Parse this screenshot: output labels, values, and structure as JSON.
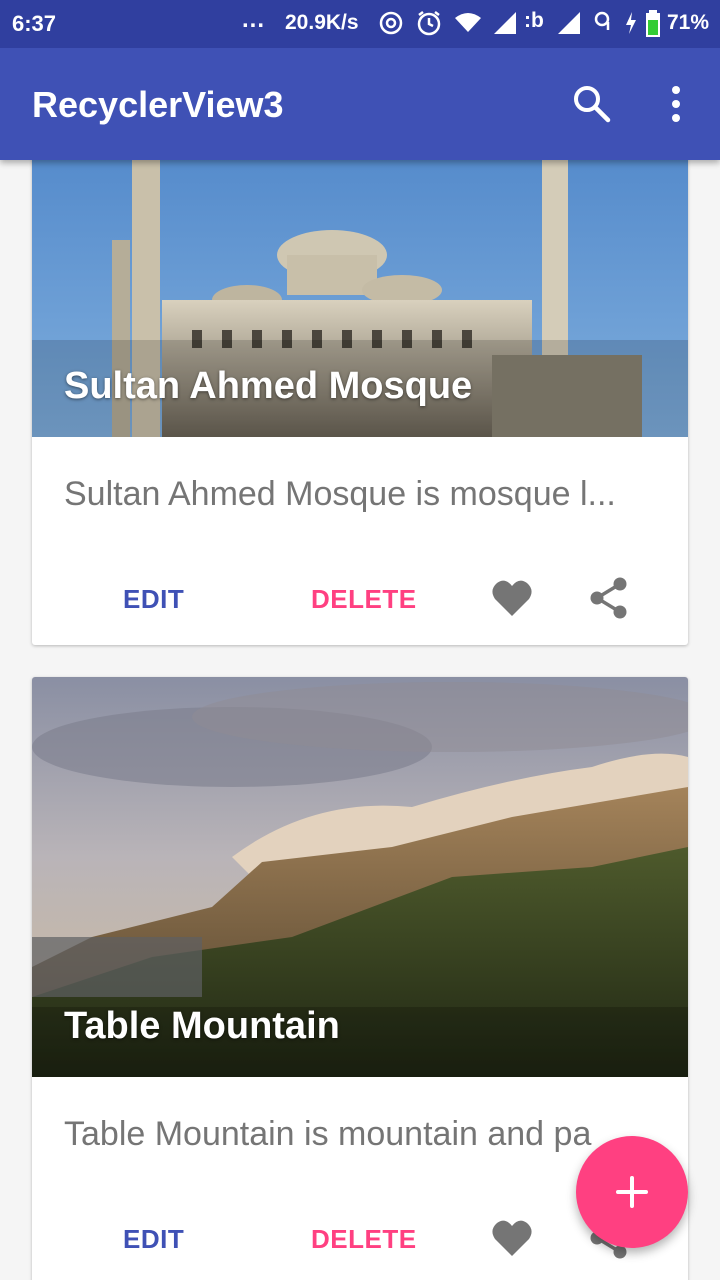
{
  "status_bar": {
    "time": "6:37",
    "dots": "...",
    "net_speed": "20.9K/s",
    "carrier_label": ":b",
    "battery": "71%"
  },
  "app_bar": {
    "title": "RecyclerView3",
    "actions": [
      "search-icon",
      "more-vert-icon"
    ]
  },
  "cards": [
    {
      "title": "Sultan Ahmed Mosque",
      "description": "Sultan Ahmed Mosque is mosque l...",
      "edit_label": "EDIT",
      "delete_label": "DELETE",
      "image": "mosque-image"
    },
    {
      "title": "Table Mountain",
      "description": "Table Mountain is mountain and pa",
      "edit_label": "EDIT",
      "delete_label": "DELETE",
      "image": "mountain-image"
    }
  ],
  "fab": {
    "icon": "plus-icon"
  },
  "colors": {
    "primary": "#3F51B5",
    "primary_dark": "#303F9F",
    "accent": "#FF4081",
    "icon_grey": "#757575"
  }
}
